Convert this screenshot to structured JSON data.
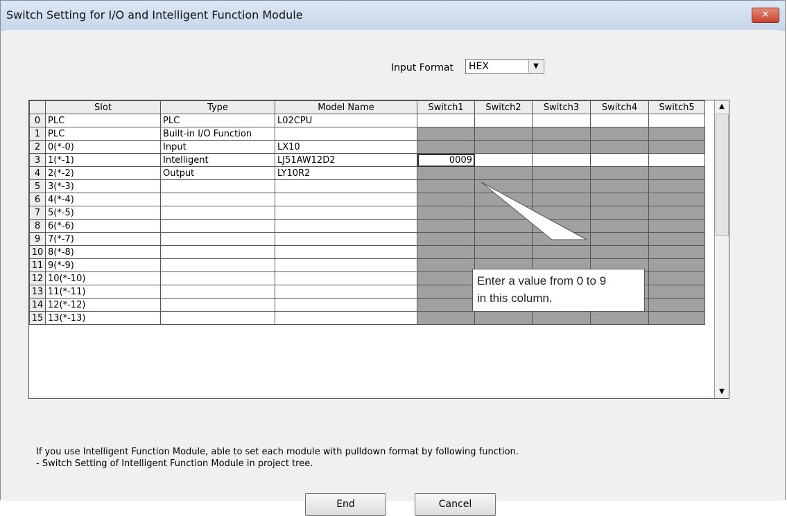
{
  "window": {
    "title": "Switch Setting for I/O and Intelligent Function Module",
    "close_glyph": "✕"
  },
  "input_format": {
    "label": "Input Format",
    "value": "HEX",
    "arrow": "▼"
  },
  "table": {
    "columns": [
      "",
      "Slot",
      "Type",
      "Model Name",
      "Switch1",
      "Switch2",
      "Switch3",
      "Switch4",
      "Switch5"
    ],
    "rows": [
      {
        "index": "0",
        "slot": "PLC",
        "type": "PLC",
        "model": "L02CPU",
        "switches": [
          "",
          "",
          "",
          "",
          ""
        ]
      },
      {
        "index": "1",
        "slot": "PLC",
        "type": "Built-in I/O Function",
        "model": "",
        "switches": [
          "",
          "",
          "",
          "",
          ""
        ]
      },
      {
        "index": "2",
        "slot": "0(*-0)",
        "type": "Input",
        "model": "LX10",
        "switches": [
          "",
          "",
          "",
          "",
          ""
        ]
      },
      {
        "index": "3",
        "slot": "1(*-1)",
        "type": "Intelligent",
        "model": "LJ51AW12D2",
        "switches": [
          "0009",
          "",
          "",
          "",
          ""
        ]
      },
      {
        "index": "4",
        "slot": "2(*-2)",
        "type": "Output",
        "model": "LY10R2",
        "switches": [
          "",
          "",
          "",
          "",
          ""
        ]
      },
      {
        "index": "5",
        "slot": "3(*-3)",
        "type": "",
        "model": "",
        "switches": [
          "",
          "",
          "",
          "",
          ""
        ]
      },
      {
        "index": "6",
        "slot": "4(*-4)",
        "type": "",
        "model": "",
        "switches": [
          "",
          "",
          "",
          "",
          ""
        ]
      },
      {
        "index": "7",
        "slot": "5(*-5)",
        "type": "",
        "model": "",
        "switches": [
          "",
          "",
          "",
          "",
          ""
        ]
      },
      {
        "index": "8",
        "slot": "6(*-6)",
        "type": "",
        "model": "",
        "switches": [
          "",
          "",
          "",
          "",
          ""
        ]
      },
      {
        "index": "9",
        "slot": "7(*-7)",
        "type": "",
        "model": "",
        "switches": [
          "",
          "",
          "",
          "",
          ""
        ]
      },
      {
        "index": "10",
        "slot": "8(*-8)",
        "type": "",
        "model": "",
        "switches": [
          "",
          "",
          "",
          "",
          ""
        ]
      },
      {
        "index": "11",
        "slot": "9(*-9)",
        "type": "",
        "model": "",
        "switches": [
          "",
          "",
          "",
          "",
          ""
        ]
      },
      {
        "index": "12",
        "slot": "10(*-10)",
        "type": "",
        "model": "",
        "switches": [
          "",
          "",
          "",
          "",
          ""
        ]
      },
      {
        "index": "13",
        "slot": "11(*-11)",
        "type": "",
        "model": "",
        "switches": [
          "",
          "",
          "",
          "",
          ""
        ]
      },
      {
        "index": "14",
        "slot": "12(*-12)",
        "type": "",
        "model": "",
        "switches": [
          "",
          "",
          "",
          "",
          ""
        ]
      },
      {
        "index": "15",
        "slot": "13(*-13)",
        "type": "",
        "model": "",
        "switches": [
          "",
          "",
          "",
          "",
          ""
        ]
      }
    ]
  },
  "scrollbar": {
    "up_glyph": "▲",
    "down_glyph": "▼"
  },
  "callout": {
    "line1": "Enter a value from 0 to 9",
    "line2": "in this column."
  },
  "info": {
    "line1": "If you use Intelligent Function Module, able to set each module with pulldown format by following function.",
    "line2": "- Switch Setting of Intelligent Function Module in project tree."
  },
  "buttons": {
    "end": "End",
    "cancel": "Cancel"
  }
}
